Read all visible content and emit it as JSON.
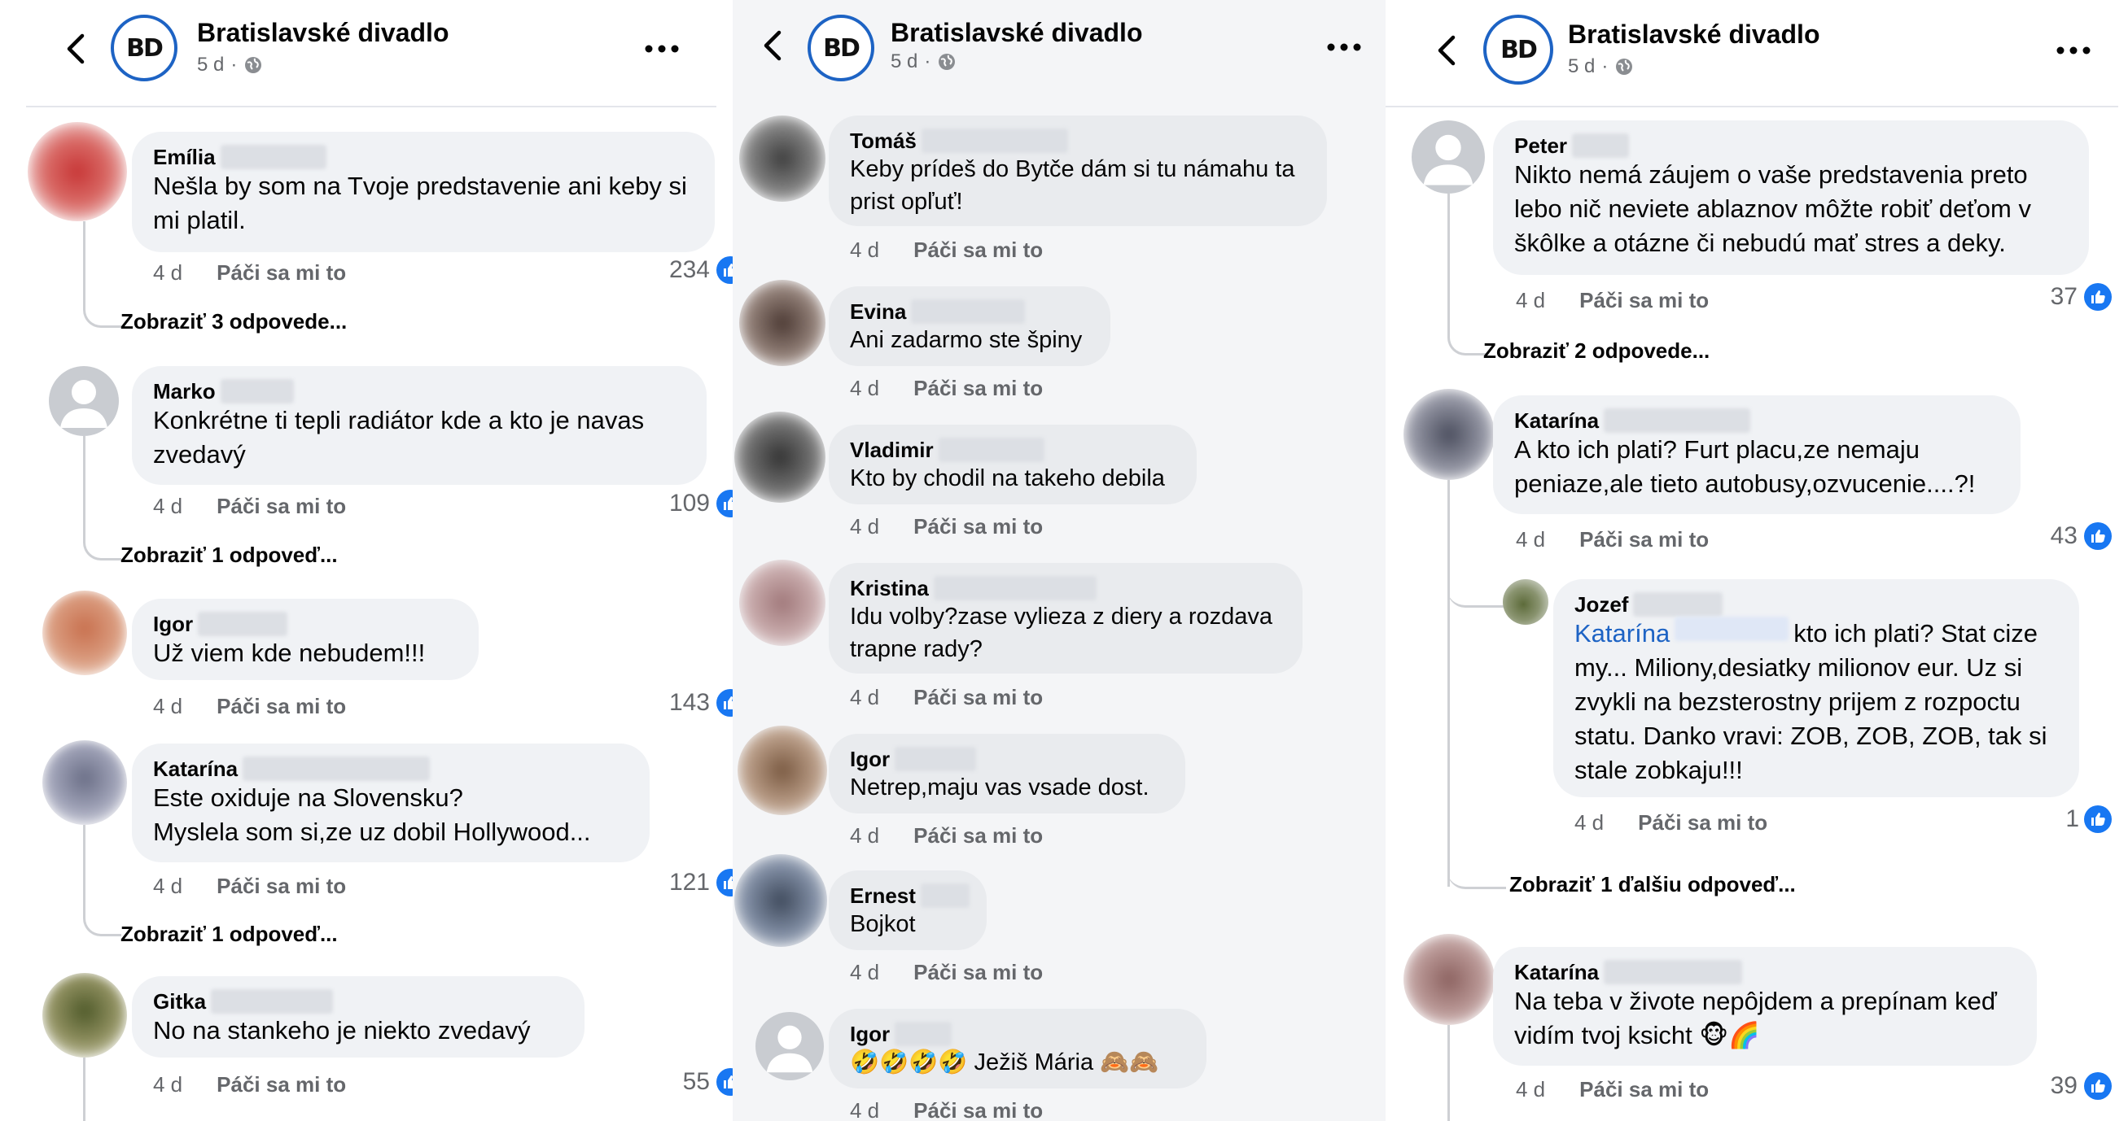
{
  "page": {
    "name": "Bratislavské divadlo",
    "age": "5 d",
    "logo_text": "BD",
    "accent": "#1d63c4",
    "like_blue": "#1877f2"
  },
  "ui": {
    "like_label": "Páči sa mi to"
  },
  "panel1": {
    "comments": [
      {
        "author": "Emília",
        "text": "Nešla by som na Tvoje predstavenie ani keby si mi platil.",
        "time": "4 d",
        "likes": "234",
        "replies": "Zobraziť 3 odpovede..."
      },
      {
        "author": "Marko",
        "text": "Konkrétne ti tepli radiátor kde a kto je navas zvedavý",
        "time": "4 d",
        "likes": "109",
        "replies": "Zobraziť 1 odpoveď..."
      },
      {
        "author": "Igor",
        "text": "Už viem kde nebudem!!!",
        "time": "4 d",
        "likes": "143",
        "replies": ""
      },
      {
        "author": "Katarína",
        "text": "Este oxiduje na Slovensku?\nMyslela som si,ze uz dobil Hollywood...",
        "time": "4 d",
        "likes": "121",
        "replies": "Zobraziť 1 odpoveď..."
      },
      {
        "author": "Gitka",
        "text": "No na stankeho je niekto zvedavý",
        "time": "4 d",
        "likes": "55",
        "replies": ""
      }
    ]
  },
  "panel2": {
    "comments": [
      {
        "author": "Tomáš",
        "text": "Keby prídeš do Bytče dám si tu námahu ta prist opľuť!",
        "time": "4 d"
      },
      {
        "author": "Evina",
        "text": "Ani zadarmo ste špiny",
        "time": "4 d"
      },
      {
        "author": "Vladimir",
        "text": "Kto by chodil na takeho debila",
        "time": "4 d"
      },
      {
        "author": "Kristina",
        "text": "Idu volby?zase vylieza z diery a rozdava trapne rady?",
        "time": "4 d"
      },
      {
        "author": "Igor",
        "text": "Netrep,maju vas vsade dost.",
        "time": "4 d"
      },
      {
        "author": "Ernest",
        "text": "Bojkot",
        "time": "4 d"
      },
      {
        "author": "Igor",
        "text": "🤣🤣🤣🤣 Ježiš Mária 🙈🙈",
        "time": "4 d"
      }
    ]
  },
  "panel3": {
    "comments": [
      {
        "author": "Peter",
        "text": "Nikto nemá záujem o vaše predstavenia preto lebo nič neviete ablaznov môžte robiť deťom v škôlke a otázne či nebudú mať stres a deky.",
        "time": "4 d",
        "likes": "37",
        "replies": "Zobraziť 2 odpovede..."
      },
      {
        "author": "Katarína",
        "text": "A kto ich plati? Furt placu,ze nemaju peniaze,ale tieto autobusy,ozvucenie....?!",
        "time": "4 d",
        "likes": "43",
        "replies": ""
      },
      {
        "author": "Jozef",
        "mention": "Katarína",
        "text": "kto ich plati? Stat cize my... Miliony,desiatky milionov eur. Uz si zvykli na bezsterostny prijem z rozpoctu statu. Danko vravi: ZOB, ZOB, ZOB, tak si stale zobkaju!!!",
        "time": "4 d",
        "likes": "1",
        "replies": "Zobraziť 1 ďalšiu odpoveď..."
      },
      {
        "author": "Katarína",
        "text": "Na teba v živote nepôjdem a prepínam keď vidím tvoj ksicht 🐵🌈",
        "time": "4 d",
        "likes": "39",
        "replies": ""
      }
    ]
  }
}
